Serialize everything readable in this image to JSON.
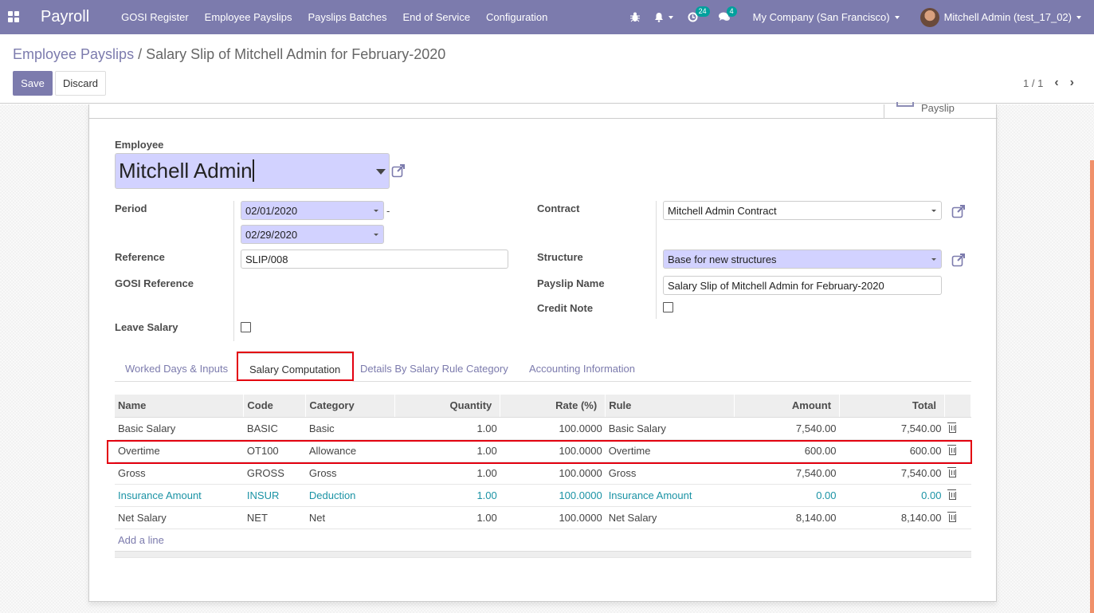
{
  "navbar": {
    "app_name": "Payroll",
    "menu": [
      "GOSI Register",
      "Employee Payslips",
      "Payslips Batches",
      "End of Service",
      "Configuration"
    ],
    "icons": [
      "bug-icon",
      "bell-icon",
      "activity-clock-icon",
      "chat-icon"
    ],
    "activity_count": "24",
    "message_count": "4",
    "company": "My Company (San Francisco)",
    "user": "Mitchell Admin (test_17_02)"
  },
  "control_panel": {
    "breadcrumb_parent": "Employee Payslips",
    "breadcrumb_separator": "/",
    "breadcrumb_current": "Salary Slip of Mitchell Admin for February-2020",
    "save_label": "Save",
    "discard_label": "Discard",
    "pager": "1 / 1"
  },
  "smart_button": {
    "label": "Payslip"
  },
  "form": {
    "employee_label": "Employee",
    "employee_value": "Mitchell Admin",
    "period_label": "Period",
    "date_from": "02/01/2020",
    "date_to": "02/29/2020",
    "period_separator": "-",
    "reference_label": "Reference",
    "reference_value": "SLIP/008",
    "gosi_reference_label": "GOSI Reference",
    "leave_salary_label": "Leave Salary",
    "leave_salary_checked": false,
    "contract_label": "Contract",
    "contract_value": "Mitchell Admin Contract",
    "structure_label": "Structure",
    "structure_value": "Base for new structures",
    "payslip_name_label": "Payslip Name",
    "payslip_name_value": "Salary Slip of Mitchell Admin for February-2020",
    "credit_note_label": "Credit Note",
    "credit_note_checked": false
  },
  "tabs": [
    {
      "label": "Worked Days & Inputs",
      "active": false
    },
    {
      "label": "Salary Computation",
      "active": true
    },
    {
      "label": "Details By Salary Rule Category",
      "active": false
    },
    {
      "label": "Accounting Information",
      "active": false
    }
  ],
  "table": {
    "columns": [
      "Name",
      "Code",
      "Category",
      "Quantity",
      "Rate (%)",
      "Rule",
      "Amount",
      "Total"
    ],
    "rows": [
      {
        "name": "Basic Salary",
        "code": "BASIC",
        "category": "Basic",
        "quantity": "1.00",
        "rate": "100.0000",
        "rule": "Basic Salary",
        "amount": "7,540.00",
        "total": "7,540.00"
      },
      {
        "name": "Overtime",
        "code": "OT100",
        "category": "Allowance",
        "quantity": "1.00",
        "rate": "100.0000",
        "rule": "Overtime",
        "amount": "600.00",
        "total": "600.00"
      },
      {
        "name": "Gross",
        "code": "GROSS",
        "category": "Gross",
        "quantity": "1.00",
        "rate": "100.0000",
        "rule": "Gross",
        "amount": "7,540.00",
        "total": "7,540.00"
      },
      {
        "name": "Insurance Amount",
        "code": "INSUR",
        "category": "Deduction",
        "quantity": "1.00",
        "rate": "100.0000",
        "rule": "Insurance Amount",
        "amount": "0.00",
        "total": "0.00"
      },
      {
        "name": "Net Salary",
        "code": "NET",
        "category": "Net",
        "quantity": "1.00",
        "rate": "100.0000",
        "rule": "Net Salary",
        "amount": "8,140.00",
        "total": "8,140.00"
      }
    ],
    "add_line_label": "Add a line"
  },
  "colors": {
    "brand": "#7c7bad",
    "required_field": "#d2d2ff",
    "badge": "#00a09d",
    "highlight": "#e3000f",
    "info_row": "#1b93a5",
    "scrollbar": "#f0906a"
  }
}
